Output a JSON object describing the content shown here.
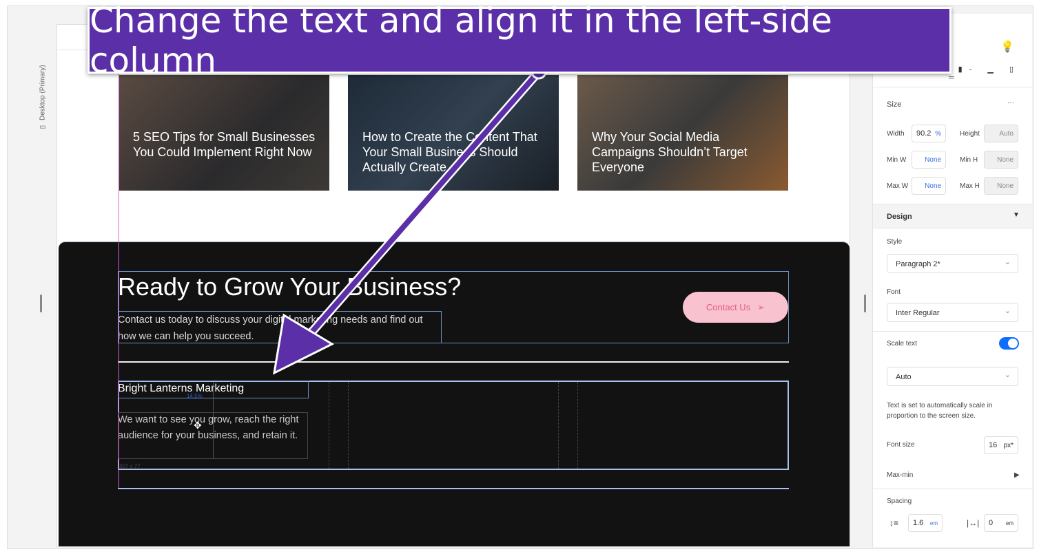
{
  "left_strip": {
    "label": "Desktop (Primary)"
  },
  "cards": [
    {
      "title": "5 SEO Tips for Small Businesses You Could Implement Right Now"
    },
    {
      "title": "How to Create the Content That Your Small Business Should Actually Create"
    },
    {
      "title": "Why Your Social Media Campaigns Shouldn’t Target Everyone"
    }
  ],
  "cta": {
    "heading": "Ready to Grow Your Business?",
    "text": "Contact us today to discuss your digital marketing needs and find out how we can help you succeed.",
    "button": "Contact Us"
  },
  "footer_col": {
    "title": "Bright Lanterns Marketing",
    "text": "We want to see you grow, reach the right audience for your business, and retain it.",
    "percent_label": "14.5%",
    "size_label": "307 x 77"
  },
  "panel": {
    "size": {
      "title": "Size",
      "more": "···",
      "width_label": "Width",
      "width": "90.2",
      "width_unit": "%",
      "height_label": "Height",
      "height": "Auto",
      "minw_label": "Min W",
      "minw": "None",
      "minh_label": "Min H",
      "minh": "None",
      "maxw_label": "Max W",
      "maxw": "None",
      "maxh_label": "Max H",
      "maxh": "None"
    },
    "design": {
      "title": "Design",
      "style_label": "Style",
      "style": "Paragraph 2*",
      "font_label": "Font",
      "font": "Inter Regular",
      "scale_label": "Scale text",
      "scale_on": true,
      "scale_mode": "Auto",
      "scale_note": "Text is set to automatically scale in proportion to the screen size.",
      "font_size_label": "Font size",
      "font_size": "16",
      "font_size_unit": "px*",
      "maxmin_label": "Max-min"
    },
    "spacing": {
      "title": "Spacing",
      "line_height": "1.6",
      "line_unit": "em",
      "letter": "0",
      "letter_unit": "em"
    }
  },
  "callout": {
    "text": "Change the text and align it in the left-side column",
    "color": "#5b2fa8"
  }
}
